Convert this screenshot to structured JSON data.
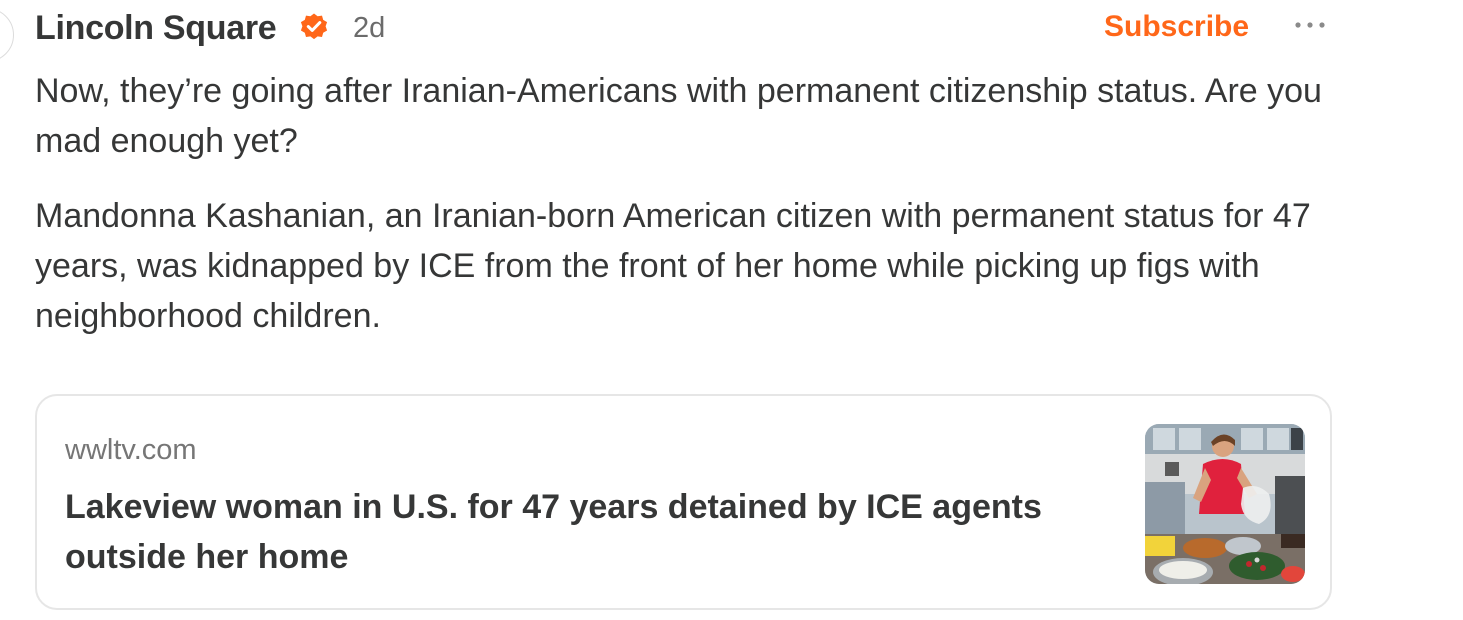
{
  "post": {
    "author": "Lincoln Square",
    "verified_icon": "verified-badge-icon",
    "timestamp": "2d",
    "subscribe_label": "Subscribe",
    "more_icon": "more-horizontal-icon",
    "paragraphs": [
      "Now, they’re going after Iranian-Americans with permanent citizenship status. Are you mad enough yet?",
      "Mandonna Kashanian, an Iranian-born American citizen with permanent status for 47 years, was kidnapped by ICE from the front of her home while picking up figs with neighborhood children."
    ]
  },
  "link_card": {
    "domain": "wwltv.com",
    "title": "Lakeview woman in U.S. for 47 years detained by ICE agents outside her home"
  },
  "colors": {
    "accent": "#ff6719",
    "text": "#363737",
    "muted": "#767676",
    "border": "#e6e6e6"
  }
}
